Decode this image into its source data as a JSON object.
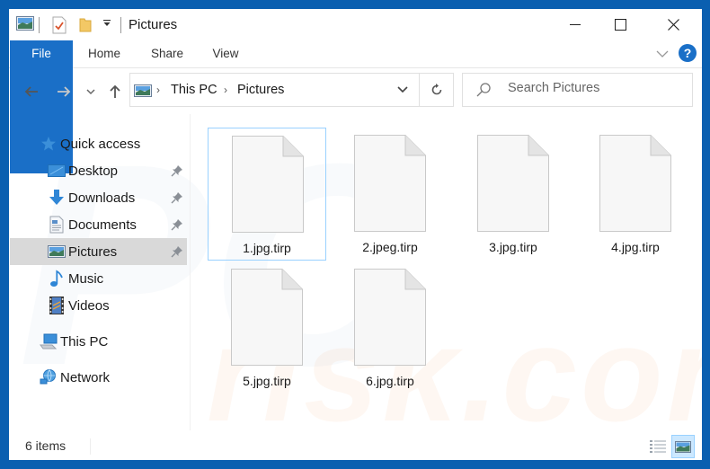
{
  "window": {
    "title": "Pictures",
    "accent_color": "#1a6fc7",
    "frame_color": "#0a5fb0"
  },
  "title_bar": {
    "quick_access_icons": [
      "pictures-icon",
      "properties-icon",
      "new-folder-icon",
      "customize-dropdown-icon"
    ],
    "controls": [
      "minimize",
      "maximize",
      "close"
    ]
  },
  "ribbon": {
    "tabs": [
      {
        "label": "File",
        "active": true
      },
      {
        "label": "Home"
      },
      {
        "label": "Share"
      },
      {
        "label": "View"
      }
    ],
    "help_label": "?"
  },
  "navigation": {
    "breadcrumb": [
      "This PC",
      "Pictures"
    ],
    "search_placeholder": "Search Pictures"
  },
  "sidebar": {
    "items": [
      {
        "label": "Quick access",
        "icon": "star-icon",
        "pinned": false,
        "level": 0
      },
      {
        "label": "Desktop",
        "icon": "desktop-icon",
        "pinned": true,
        "level": 1
      },
      {
        "label": "Downloads",
        "icon": "download-icon",
        "pinned": true,
        "level": 1
      },
      {
        "label": "Documents",
        "icon": "documents-icon",
        "pinned": true,
        "level": 1
      },
      {
        "label": "Pictures",
        "icon": "pictures-icon",
        "pinned": true,
        "level": 1,
        "selected": true
      },
      {
        "label": "Music",
        "icon": "music-icon",
        "pinned": false,
        "level": 1
      },
      {
        "label": "Videos",
        "icon": "videos-icon",
        "pinned": false,
        "level": 1
      },
      {
        "label": "This PC",
        "icon": "computer-icon",
        "pinned": false,
        "level": 0
      },
      {
        "label": "Network",
        "icon": "network-icon",
        "pinned": false,
        "level": 0
      }
    ]
  },
  "files": [
    {
      "name": "1.jpg.tirp",
      "selected": true
    },
    {
      "name": "2.jpeg.tirp"
    },
    {
      "name": "3.jpg.tirp"
    },
    {
      "name": "4.jpg.tirp"
    },
    {
      "name": "5.jpg.tirp"
    },
    {
      "name": "6.jpg.tirp"
    }
  ],
  "status_bar": {
    "item_count": "6 items",
    "view_modes": [
      "details",
      "large-icons"
    ],
    "active_view": "large-icons"
  },
  "watermark": "risk.com"
}
